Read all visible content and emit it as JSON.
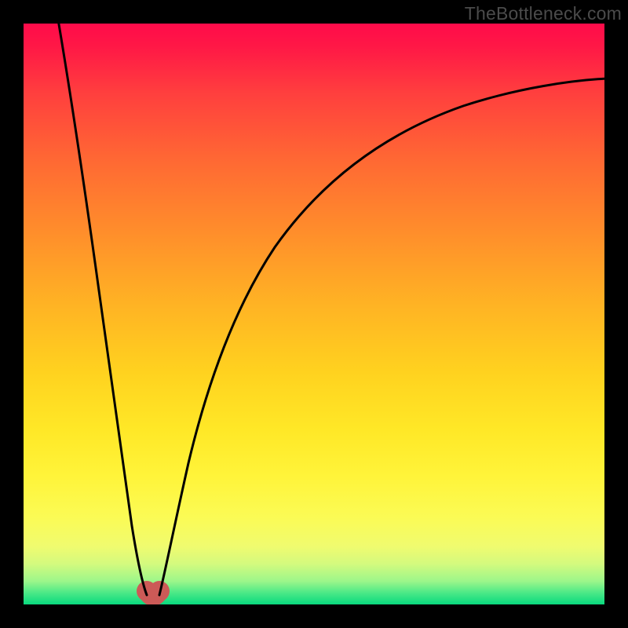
{
  "watermark": "TheBottleneck.com",
  "chart_data": {
    "type": "line",
    "title": "",
    "xlabel": "",
    "ylabel": "",
    "xlim": [
      0,
      1
    ],
    "ylim": [
      0,
      1
    ],
    "note": "Axes are unlabeled; values are normalized 0-1 in plot coordinates. y represents approximate vertical position of the curve from bottom (0) to top (1).",
    "series": [
      {
        "name": "left-branch",
        "x": [
          0.06,
          0.08,
          0.1,
          0.12,
          0.14,
          0.16,
          0.18,
          0.195,
          0.205,
          0.213
        ],
        "y": [
          1.0,
          0.83,
          0.68,
          0.54,
          0.41,
          0.29,
          0.175,
          0.085,
          0.035,
          0.015
        ]
      },
      {
        "name": "right-branch",
        "x": [
          0.232,
          0.25,
          0.28,
          0.32,
          0.37,
          0.43,
          0.5,
          0.58,
          0.67,
          0.77,
          0.88,
          1.0
        ],
        "y": [
          0.015,
          0.08,
          0.19,
          0.32,
          0.44,
          0.55,
          0.645,
          0.72,
          0.78,
          0.83,
          0.87,
          0.905
        ]
      }
    ],
    "markers": [
      {
        "name": "valley-left",
        "x": 0.213,
        "y": 0.015,
        "color": "#cc5a57",
        "r": 13
      },
      {
        "name": "valley-right",
        "x": 0.232,
        "y": 0.015,
        "color": "#cc5a57",
        "r": 13
      }
    ],
    "background_gradient": {
      "top": "#ff0b4a",
      "mid": "#ffd21f",
      "bottom": "#09d97e"
    }
  }
}
